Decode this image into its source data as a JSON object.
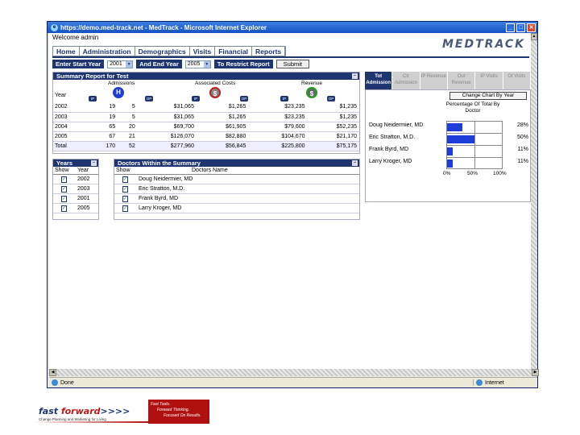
{
  "window": {
    "title": "https://demo.med-track.net - MedTrack - Microsoft Internet Explorer",
    "status": "Done",
    "zone": "Internet"
  },
  "app": {
    "welcome": "Welcome admin",
    "logo": "MEDTRACK",
    "nav": [
      "Home",
      "Administration",
      "Demographics",
      "Visits",
      "Financial",
      "Reports"
    ]
  },
  "filter": {
    "start_label": "Enter Start Year",
    "start_value": "2001",
    "end_label": "And End Year",
    "end_value": "2005",
    "restrict_label": "To Restrict Report",
    "submit": "Submit"
  },
  "summary": {
    "title": "Summary Report for Test",
    "col_labels": [
      "Admissions",
      "Associated Costs",
      "Revenue"
    ],
    "year_label": "Year",
    "rows": [
      [
        "2002",
        "19",
        "5",
        "$31,065",
        "$1,265",
        "$23,235",
        "$1,235"
      ],
      [
        "2003",
        "19",
        "5",
        "$31,065",
        "$1,265",
        "$23,235",
        "$1,235"
      ],
      [
        "2004",
        "65",
        "20",
        "$69,700",
        "$61,905",
        "$79,600",
        "$52,235"
      ],
      [
        "2005",
        "67",
        "21",
        "$126,070",
        "$82,880",
        "$104,670",
        "$21,170"
      ]
    ],
    "total": [
      "Total",
      "170",
      "52",
      "$277,960",
      "$56,845",
      "$225,800",
      "$75,175"
    ]
  },
  "years_panel": {
    "title": "Years",
    "show": "Show",
    "year": "Year",
    "items": [
      "2002",
      "2003",
      "2001",
      "2005"
    ]
  },
  "doctors_panel": {
    "title": "Doctors Within the Summary",
    "show": "Show",
    "name_col": "Doctors Name",
    "items": [
      "Doug Neidermier, MD",
      "Eric Stratton, M.D.",
      "Frank Byrd, MD",
      "Larry Kroger, MD"
    ]
  },
  "chart_tabs": [
    "Tot Admission",
    "Ctr Admission",
    "IP Revenue",
    "Out Revenue",
    "IP Visits",
    "Ot Visits"
  ],
  "chart_button": "Change Chart By Year",
  "chart_data": {
    "type": "bar",
    "title": "Percentage Of Total By Doctor",
    "categories": [
      "Doug Neidermier, MD",
      "Eric Stratton, M.D.",
      "Frank Byrd, MD",
      "Larry Kroger, MD"
    ],
    "values": [
      28,
      50,
      11,
      11
    ],
    "value_labels": [
      "28%",
      "50%",
      "11%",
      "11%"
    ],
    "x_ticks": [
      "0%",
      "50%",
      "100%"
    ],
    "xlim": [
      0,
      100
    ],
    "orientation": "horizontal",
    "color": "#1e3cd8"
  },
  "banner": {
    "logo_a": "fast ",
    "logo_b": "forward",
    "logo_c": ">>>>",
    "tagline": "Change Planning and Marketing for Living",
    "red_lines": [
      "Fast Tools.",
      "Forward Thinking.",
      "Focused On Results."
    ]
  }
}
